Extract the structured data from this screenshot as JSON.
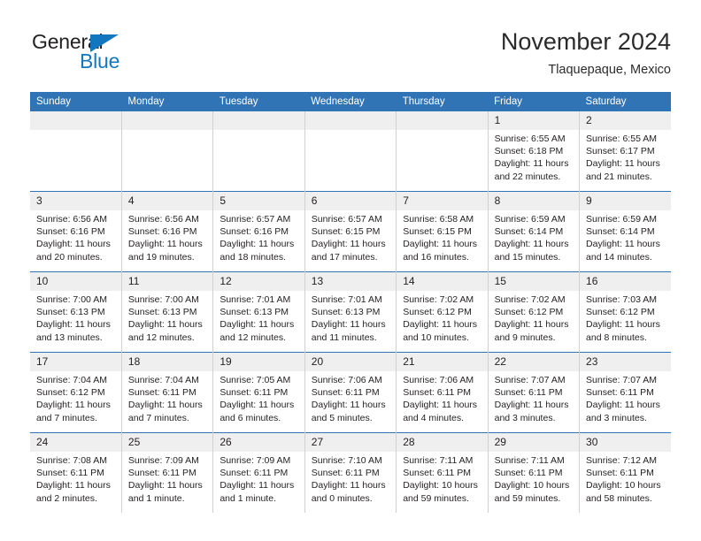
{
  "brand": {
    "name_part1": "General",
    "name_part2": "Blue",
    "logo_icon": "blue-triangle-icon",
    "color_primary": "#1277be",
    "color_text": "#221f1f"
  },
  "header": {
    "title": "November 2024",
    "subtitle": "Tlaquepaque, Mexico"
  },
  "theme": {
    "header_row_bg": "#3174b5",
    "header_row_text": "#ffffff",
    "daynum_bg": "#efefef",
    "cell_border": "#d0d0d0",
    "row_separator": "#3174b5",
    "body_text": "#231f20"
  },
  "calendar": {
    "month": "November",
    "year": "2024",
    "location": "Tlaquepaque, Mexico",
    "weekday_headers": [
      "Sunday",
      "Monday",
      "Tuesday",
      "Wednesday",
      "Thursday",
      "Friday",
      "Saturday"
    ],
    "weeks": [
      [
        {
          "day": "",
          "empty": true
        },
        {
          "day": "",
          "empty": true
        },
        {
          "day": "",
          "empty": true
        },
        {
          "day": "",
          "empty": true
        },
        {
          "day": "",
          "empty": true
        },
        {
          "day": "1",
          "sunrise": "Sunrise: 6:55 AM",
          "sunset": "Sunset: 6:18 PM",
          "daylight": "Daylight: 11 hours and 22 minutes."
        },
        {
          "day": "2",
          "sunrise": "Sunrise: 6:55 AM",
          "sunset": "Sunset: 6:17 PM",
          "daylight": "Daylight: 11 hours and 21 minutes."
        }
      ],
      [
        {
          "day": "3",
          "sunrise": "Sunrise: 6:56 AM",
          "sunset": "Sunset: 6:16 PM",
          "daylight": "Daylight: 11 hours and 20 minutes."
        },
        {
          "day": "4",
          "sunrise": "Sunrise: 6:56 AM",
          "sunset": "Sunset: 6:16 PM",
          "daylight": "Daylight: 11 hours and 19 minutes."
        },
        {
          "day": "5",
          "sunrise": "Sunrise: 6:57 AM",
          "sunset": "Sunset: 6:16 PM",
          "daylight": "Daylight: 11 hours and 18 minutes."
        },
        {
          "day": "6",
          "sunrise": "Sunrise: 6:57 AM",
          "sunset": "Sunset: 6:15 PM",
          "daylight": "Daylight: 11 hours and 17 minutes."
        },
        {
          "day": "7",
          "sunrise": "Sunrise: 6:58 AM",
          "sunset": "Sunset: 6:15 PM",
          "daylight": "Daylight: 11 hours and 16 minutes."
        },
        {
          "day": "8",
          "sunrise": "Sunrise: 6:59 AM",
          "sunset": "Sunset: 6:14 PM",
          "daylight": "Daylight: 11 hours and 15 minutes."
        },
        {
          "day": "9",
          "sunrise": "Sunrise: 6:59 AM",
          "sunset": "Sunset: 6:14 PM",
          "daylight": "Daylight: 11 hours and 14 minutes."
        }
      ],
      [
        {
          "day": "10",
          "sunrise": "Sunrise: 7:00 AM",
          "sunset": "Sunset: 6:13 PM",
          "daylight": "Daylight: 11 hours and 13 minutes."
        },
        {
          "day": "11",
          "sunrise": "Sunrise: 7:00 AM",
          "sunset": "Sunset: 6:13 PM",
          "daylight": "Daylight: 11 hours and 12 minutes."
        },
        {
          "day": "12",
          "sunrise": "Sunrise: 7:01 AM",
          "sunset": "Sunset: 6:13 PM",
          "daylight": "Daylight: 11 hours and 12 minutes."
        },
        {
          "day": "13",
          "sunrise": "Sunrise: 7:01 AM",
          "sunset": "Sunset: 6:13 PM",
          "daylight": "Daylight: 11 hours and 11 minutes."
        },
        {
          "day": "14",
          "sunrise": "Sunrise: 7:02 AM",
          "sunset": "Sunset: 6:12 PM",
          "daylight": "Daylight: 11 hours and 10 minutes."
        },
        {
          "day": "15",
          "sunrise": "Sunrise: 7:02 AM",
          "sunset": "Sunset: 6:12 PM",
          "daylight": "Daylight: 11 hours and 9 minutes."
        },
        {
          "day": "16",
          "sunrise": "Sunrise: 7:03 AM",
          "sunset": "Sunset: 6:12 PM",
          "daylight": "Daylight: 11 hours and 8 minutes."
        }
      ],
      [
        {
          "day": "17",
          "sunrise": "Sunrise: 7:04 AM",
          "sunset": "Sunset: 6:12 PM",
          "daylight": "Daylight: 11 hours and 7 minutes."
        },
        {
          "day": "18",
          "sunrise": "Sunrise: 7:04 AM",
          "sunset": "Sunset: 6:11 PM",
          "daylight": "Daylight: 11 hours and 7 minutes."
        },
        {
          "day": "19",
          "sunrise": "Sunrise: 7:05 AM",
          "sunset": "Sunset: 6:11 PM",
          "daylight": "Daylight: 11 hours and 6 minutes."
        },
        {
          "day": "20",
          "sunrise": "Sunrise: 7:06 AM",
          "sunset": "Sunset: 6:11 PM",
          "daylight": "Daylight: 11 hours and 5 minutes."
        },
        {
          "day": "21",
          "sunrise": "Sunrise: 7:06 AM",
          "sunset": "Sunset: 6:11 PM",
          "daylight": "Daylight: 11 hours and 4 minutes."
        },
        {
          "day": "22",
          "sunrise": "Sunrise: 7:07 AM",
          "sunset": "Sunset: 6:11 PM",
          "daylight": "Daylight: 11 hours and 3 minutes."
        },
        {
          "day": "23",
          "sunrise": "Sunrise: 7:07 AM",
          "sunset": "Sunset: 6:11 PM",
          "daylight": "Daylight: 11 hours and 3 minutes."
        }
      ],
      [
        {
          "day": "24",
          "sunrise": "Sunrise: 7:08 AM",
          "sunset": "Sunset: 6:11 PM",
          "daylight": "Daylight: 11 hours and 2 minutes."
        },
        {
          "day": "25",
          "sunrise": "Sunrise: 7:09 AM",
          "sunset": "Sunset: 6:11 PM",
          "daylight": "Daylight: 11 hours and 1 minute."
        },
        {
          "day": "26",
          "sunrise": "Sunrise: 7:09 AM",
          "sunset": "Sunset: 6:11 PM",
          "daylight": "Daylight: 11 hours and 1 minute."
        },
        {
          "day": "27",
          "sunrise": "Sunrise: 7:10 AM",
          "sunset": "Sunset: 6:11 PM",
          "daylight": "Daylight: 11 hours and 0 minutes."
        },
        {
          "day": "28",
          "sunrise": "Sunrise: 7:11 AM",
          "sunset": "Sunset: 6:11 PM",
          "daylight": "Daylight: 10 hours and 59 minutes."
        },
        {
          "day": "29",
          "sunrise": "Sunrise: 7:11 AM",
          "sunset": "Sunset: 6:11 PM",
          "daylight": "Daylight: 10 hours and 59 minutes."
        },
        {
          "day": "30",
          "sunrise": "Sunrise: 7:12 AM",
          "sunset": "Sunset: 6:11 PM",
          "daylight": "Daylight: 10 hours and 58 minutes."
        }
      ]
    ]
  }
}
